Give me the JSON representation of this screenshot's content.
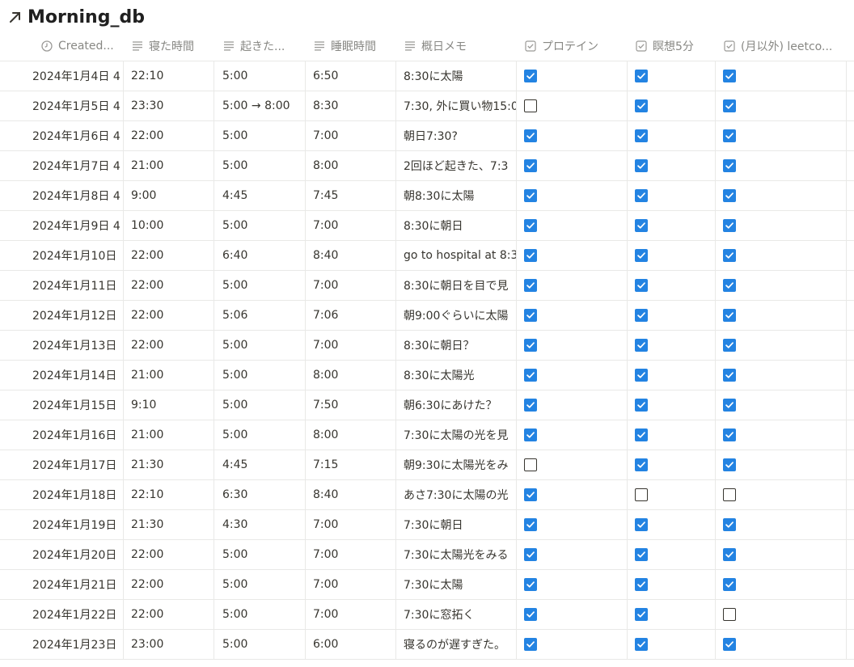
{
  "title": "Morning_db",
  "columns": [
    {
      "label": "Created...",
      "icon": "clock-icon"
    },
    {
      "label": "寝た時間",
      "icon": "text-lines-icon"
    },
    {
      "label": "起きた...",
      "icon": "text-lines-icon"
    },
    {
      "label": "睡眠時間",
      "icon": "text-lines-icon"
    },
    {
      "label": "概日メモ",
      "icon": "text-lines-icon"
    },
    {
      "label": "プロテイン",
      "icon": "checkbox-property-icon"
    },
    {
      "label": "瞑想5分",
      "icon": "checkbox-property-icon"
    },
    {
      "label": "(月以外) leetco...",
      "icon": "checkbox-property-icon"
    }
  ],
  "rows": [
    {
      "created": "2024年1月4日 4",
      "slept": "22:10",
      "woke": "5:00",
      "duration": "6:50",
      "memo": "8:30に太陽",
      "protein": true,
      "meditation": true,
      "leetcode": true
    },
    {
      "created": "2024年1月5日 4",
      "slept": "23:30",
      "woke": "5:00 → 8:00",
      "duration": "8:30",
      "memo": "7:30, 外に買い物15:0",
      "protein": false,
      "meditation": true,
      "leetcode": true
    },
    {
      "created": "2024年1月6日 4",
      "slept": "22:00",
      "woke": "5:00",
      "duration": "7:00",
      "memo": "朝日7:30?",
      "protein": true,
      "meditation": true,
      "leetcode": true
    },
    {
      "created": "2024年1月7日 4",
      "slept": "21:00",
      "woke": "5:00",
      "duration": "8:00",
      "memo": "2回ほど起きた、7:3",
      "protein": true,
      "meditation": true,
      "leetcode": true
    },
    {
      "created": "2024年1月8日 4",
      "slept": "9:00",
      "woke": "4:45",
      "duration": "7:45",
      "memo": "朝8:30に太陽",
      "protein": true,
      "meditation": true,
      "leetcode": true
    },
    {
      "created": "2024年1月9日 4",
      "slept": "10:00",
      "woke": "5:00",
      "duration": "7:00",
      "memo": "8:30に朝日",
      "protein": true,
      "meditation": true,
      "leetcode": true
    },
    {
      "created": "2024年1月10日",
      "slept": "22:00",
      "woke": "6:40",
      "duration": "8:40",
      "memo": "go to hospital at 8:3",
      "protein": true,
      "meditation": true,
      "leetcode": true
    },
    {
      "created": "2024年1月11日",
      "slept": "22:00",
      "woke": "5:00",
      "duration": "7:00",
      "memo": "8:30に朝日を目で見",
      "protein": true,
      "meditation": true,
      "leetcode": true
    },
    {
      "created": "2024年1月12日",
      "slept": "22:00",
      "woke": "5:06",
      "duration": "7:06",
      "memo": "朝9:00ぐらいに太陽",
      "protein": true,
      "meditation": true,
      "leetcode": true
    },
    {
      "created": "2024年1月13日",
      "slept": "22:00",
      "woke": "5:00",
      "duration": "7:00",
      "memo": "8:30に朝日？",
      "protein": true,
      "meditation": true,
      "leetcode": true
    },
    {
      "created": "2024年1月14日",
      "slept": "21:00",
      "woke": "5:00",
      "duration": "8:00",
      "memo": "8:30に太陽光",
      "protein": true,
      "meditation": true,
      "leetcode": true
    },
    {
      "created": "2024年1月15日",
      "slept": "9:10",
      "woke": "5:00",
      "duration": "7:50",
      "memo": "朝6:30にあけた？",
      "protein": true,
      "meditation": true,
      "leetcode": true
    },
    {
      "created": "2024年1月16日",
      "slept": "21:00",
      "woke": "5:00",
      "duration": "8:00",
      "memo": "7:30に太陽の光を見",
      "protein": true,
      "meditation": true,
      "leetcode": true
    },
    {
      "created": "2024年1月17日",
      "slept": "21:30",
      "woke": "4:45",
      "duration": "7:15",
      "memo": "朝9:30に太陽光をみ",
      "protein": false,
      "meditation": true,
      "leetcode": true
    },
    {
      "created": "2024年1月18日",
      "slept": "22:10",
      "woke": "6:30",
      "duration": "8:40",
      "memo": "あさ7:30に太陽の光",
      "protein": true,
      "meditation": false,
      "leetcode": false
    },
    {
      "created": "2024年1月19日",
      "slept": "21:30",
      "woke": "4:30",
      "duration": "7:00",
      "memo": "7:30に朝日",
      "protein": true,
      "meditation": true,
      "leetcode": true
    },
    {
      "created": "2024年1月20日",
      "slept": "22:00",
      "woke": "5:00",
      "duration": "7:00",
      "memo": "7:30に太陽光をみる",
      "protein": true,
      "meditation": true,
      "leetcode": true
    },
    {
      "created": "2024年1月21日",
      "slept": "22:00",
      "woke": "5:00",
      "duration": "7:00",
      "memo": "7:30に太陽",
      "protein": true,
      "meditation": true,
      "leetcode": true
    },
    {
      "created": "2024年1月22日",
      "slept": "22:00",
      "woke": "5:00",
      "duration": "7:00",
      "memo": "7:30に窓拓く",
      "protein": true,
      "meditation": true,
      "leetcode": false
    },
    {
      "created": "2024年1月23日",
      "slept": "23:00",
      "woke": "5:00",
      "duration": "6:00",
      "memo": "寝るのが遅すぎた。",
      "protein": true,
      "meditation": true,
      "leetcode": true
    }
  ],
  "colors": {
    "checkbox_on": "#2383e2",
    "border": "#e9e9e7",
    "text": "#37352f",
    "header_text": "#888884"
  }
}
